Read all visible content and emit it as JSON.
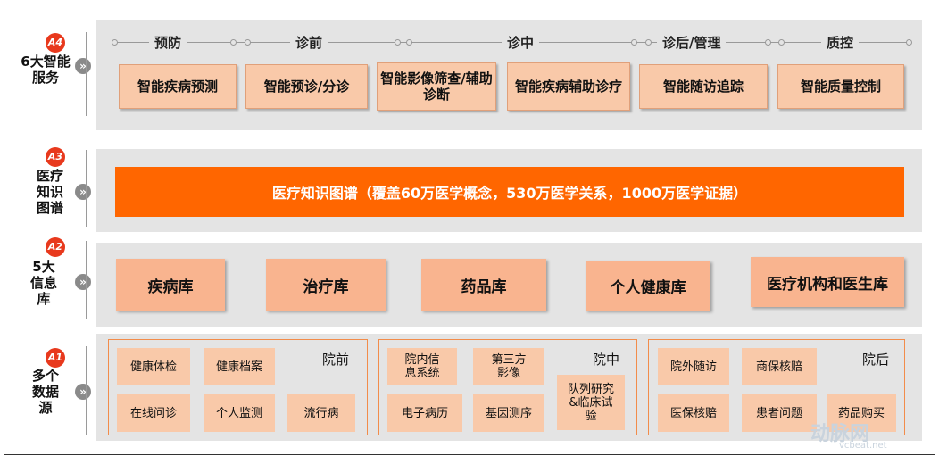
{
  "rows": {
    "a4": {
      "badge": "A4",
      "label": "6大智能服务"
    },
    "a3": {
      "badge": "A3",
      "label": "医疗知识图谱"
    },
    "a2": {
      "badge": "A2",
      "label": "5大信息库"
    },
    "a1": {
      "badge": "A1",
      "label": "多个数据源"
    }
  },
  "stages": [
    "预防",
    "诊前",
    "诊中",
    "诊后/管理",
    "质控"
  ],
  "services": [
    "智能疾病预测",
    "智能预诊/分诊",
    "智能影像筛查/辅助诊断",
    "智能疾病辅助诊疗",
    "智能随访追踪",
    "智能质量控制"
  ],
  "knowledge_graph": "医疗知识图谱（覆盖60万医学概念，530万医学关系，1000万医学证据）",
  "libraries": [
    "疾病库",
    "治疗库",
    "药品库",
    "个人健康库",
    "医疗机构和医生库"
  ],
  "source_groups": [
    {
      "title": "院前",
      "items": [
        "健康体检",
        "健康档案",
        "在线问诊",
        "个人监测",
        "流行病"
      ]
    },
    {
      "title": "院中",
      "items": [
        "院内信息系统",
        "第三方影像",
        "电子病历",
        "基因测序",
        "队列研究&临床试验"
      ]
    },
    {
      "title": "院后",
      "items": [
        "院外随访",
        "商保核赔",
        "医保核赔",
        "患者问题",
        "药品购买"
      ]
    }
  ],
  "watermark": {
    "main": "动脉网",
    "sub": "vcbeat.net"
  },
  "colors": {
    "accent": "#ff6600",
    "badge": "#e8391d",
    "panel": "#e4e4e4",
    "service": "#f9c9a9",
    "library": "#f9b48f"
  }
}
